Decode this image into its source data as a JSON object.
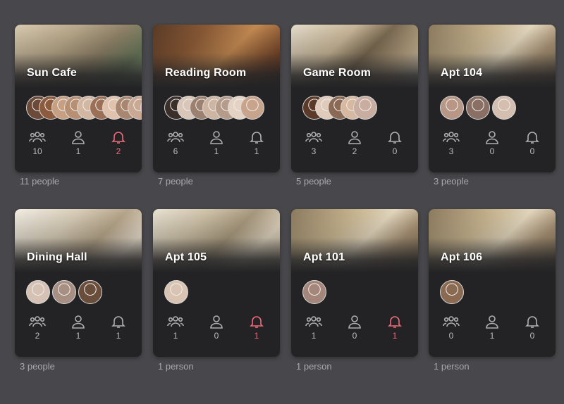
{
  "rooms": [
    {
      "name": "Sun Cafe",
      "residents": "10",
      "staff": "1",
      "alerts": "2",
      "alert_active": true,
      "people": "11 people",
      "avatar_colors": [
        "#6b4a3a",
        "#8c5a3c",
        "#c7a083",
        "#b79074",
        "#d2b7a3",
        "#9c6f57",
        "#e0c2ad",
        "#a88670",
        "#c9a993",
        "#d8b8c8"
      ]
    },
    {
      "name": "Reading Room",
      "residents": "6",
      "staff": "1",
      "alerts": "1",
      "alert_active": false,
      "people": "7 people",
      "avatar_colors": [
        "#3a2f2a",
        "#d9c6b8",
        "#9d8170",
        "#cdb5a2",
        "#b59c8a",
        "#e4d2c4",
        "#c8a48c"
      ]
    },
    {
      "name": "Game Room",
      "residents": "3",
      "staff": "2",
      "alerts": "0",
      "alert_active": false,
      "people": "5 people",
      "avatar_colors": [
        "#5b3a2a",
        "#e0cbbb",
        "#8b6a55",
        "#d7b8a1",
        "#c9ada0"
      ]
    },
    {
      "name": "Apt 104",
      "residents": "3",
      "staff": "0",
      "alerts": "0",
      "alert_active": false,
      "people": "3 people",
      "avatar_colors": [
        "#b89787",
        "#8a7064",
        "#d4beb0"
      ]
    },
    {
      "name": "Dining Hall",
      "residents": "2",
      "staff": "1",
      "alerts": "1",
      "alert_active": false,
      "people": "3 people",
      "avatar_colors": [
        "#d6c2b5",
        "#a79083",
        "#6a4e3c"
      ]
    },
    {
      "name": "Apt 105",
      "residents": "1",
      "staff": "0",
      "alerts": "1",
      "alert_active": true,
      "people": "1 person",
      "avatar_colors": [
        "#d9c4b4"
      ]
    },
    {
      "name": "Apt 101",
      "residents": "1",
      "staff": "0",
      "alerts": "1",
      "alert_active": true,
      "people": "1 person",
      "avatar_colors": [
        "#a4867a"
      ]
    },
    {
      "name": "Apt 106",
      "residents": "0",
      "staff": "1",
      "alerts": "0",
      "alert_active": false,
      "people": "1 person",
      "avatar_colors": [
        "#8a6a52"
      ]
    }
  ],
  "icons": {
    "residents": "group-icon",
    "staff": "person-icon",
    "alerts": "bell-icon"
  },
  "colors": {
    "background": "#48484c",
    "card": "#232325",
    "alert": "#f06b7a",
    "caption": "#a8a8ac"
  }
}
